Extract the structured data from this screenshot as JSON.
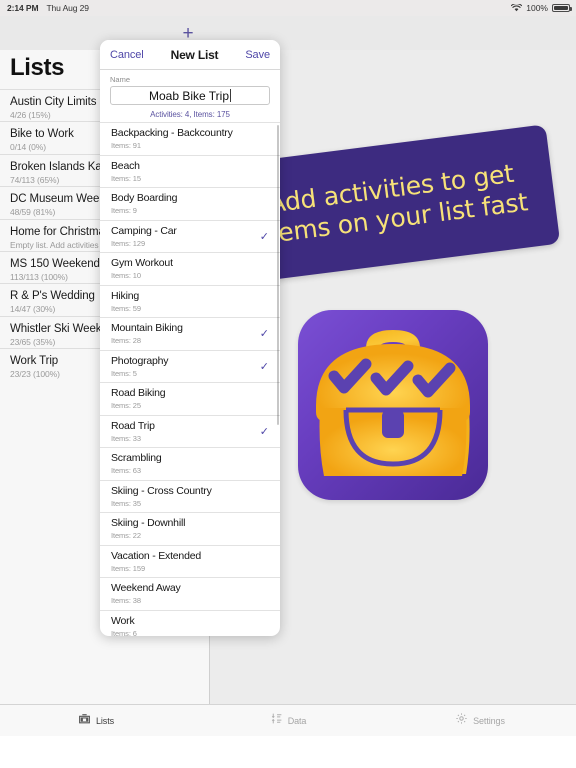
{
  "statusbar": {
    "time": "2:14 PM",
    "date": "Thu Aug 29",
    "wifi_icon": "wifi-icon",
    "battery_percent": "100%",
    "battery_icon": "battery-icon"
  },
  "toolbar": {
    "add_icon": "plus-icon",
    "add_label": "+"
  },
  "sidebar": {
    "title": "Lists",
    "items": [
      {
        "name": "Austin City Limits",
        "detail": "4/26  (15%)"
      },
      {
        "name": "Bike to Work",
        "detail": "0/14  (0%)"
      },
      {
        "name": "Broken Islands Kayak T",
        "detail": "74/113  (65%)"
      },
      {
        "name": "DC Museum Weekend",
        "detail": "48/59  (81%)"
      },
      {
        "name": "Home for Christmas",
        "detail": "Empty list. Add activities or ite"
      },
      {
        "name": "MS 150 Weekend",
        "detail": "113/113  (100%)"
      },
      {
        "name": "R & P's Wedding",
        "detail": "14/47  (30%)"
      },
      {
        "name": "Whistler Ski Weekend",
        "detail": "23/65  (35%)"
      },
      {
        "name": "Work Trip",
        "detail": "23/23  (100%)"
      }
    ]
  },
  "promo": {
    "text": "Add activities to get items on your list fast",
    "background_color": "#3d2b80",
    "text_color": "#f7e278"
  },
  "app_icon": {
    "name": "backpack-checklist-app-icon",
    "background_gradient_from": "#7a4fd4",
    "background_gradient_to": "#4a2a96",
    "bag_color": "#f5b31c",
    "check_color": "#5b42b0"
  },
  "modal": {
    "cancel_label": "Cancel",
    "title": "New List",
    "save_label": "Save",
    "name_field_label": "Name",
    "name_field_value": "Moab Bike Trip",
    "name_field_placeholder": "Name",
    "summary": "Activities: 4, Items: 175",
    "accent_color": "#4f47a8",
    "activities": [
      {
        "name": "Backpacking - Backcountry",
        "items": "Items: 91",
        "selected": false
      },
      {
        "name": "Beach",
        "items": "Items: 15",
        "selected": false
      },
      {
        "name": "Body Boarding",
        "items": "Items: 9",
        "selected": false
      },
      {
        "name": "Camping - Car",
        "items": "Items: 129",
        "selected": true
      },
      {
        "name": "Gym Workout",
        "items": "Items: 10",
        "selected": false
      },
      {
        "name": "Hiking",
        "items": "Items: 59",
        "selected": false
      },
      {
        "name": "Mountain Biking",
        "items": "Items: 28",
        "selected": true
      },
      {
        "name": "Photography",
        "items": "Items: 5",
        "selected": true
      },
      {
        "name": "Road Biking",
        "items": "Items: 25",
        "selected": false
      },
      {
        "name": "Road Trip",
        "items": "Items: 33",
        "selected": true
      },
      {
        "name": "Scrambling",
        "items": "Items: 63",
        "selected": false
      },
      {
        "name": "Skiing - Cross Country",
        "items": "Items: 35",
        "selected": false
      },
      {
        "name": "Skiing - Downhill",
        "items": "Items: 22",
        "selected": false
      },
      {
        "name": "Vacation - Extended",
        "items": "Items: 159",
        "selected": false
      },
      {
        "name": "Weekend Away",
        "items": "Items: 38",
        "selected": false
      },
      {
        "name": "Work",
        "items": "Items: 6",
        "selected": false
      }
    ],
    "check_glyph": "✓"
  },
  "tabbar": {
    "tabs": [
      {
        "label": "Lists",
        "icon": "backpack-icon",
        "active": true
      },
      {
        "label": "Data",
        "icon": "sort-list-icon",
        "active": false
      },
      {
        "label": "Settings",
        "icon": "gear-icon",
        "active": false
      }
    ]
  }
}
